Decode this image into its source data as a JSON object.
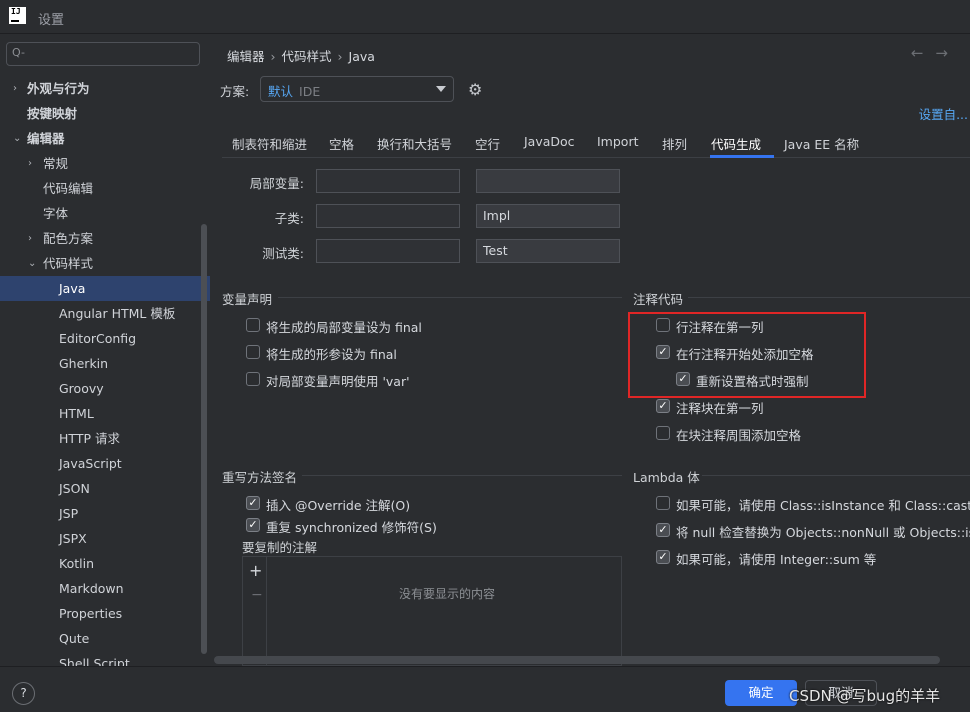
{
  "window": {
    "title": "设置",
    "app_icon_text": "IJ"
  },
  "sidebar": {
    "search_placeholder": "Q-",
    "items": [
      {
        "label": "外观与行为",
        "level": 0,
        "chevron": "›",
        "bold": true
      },
      {
        "label": "按键映射",
        "level": 0,
        "chevron": "",
        "bold": true
      },
      {
        "label": "编辑器",
        "level": 0,
        "chevron": "⌄",
        "bold": true
      },
      {
        "label": "常规",
        "level": 1,
        "chevron": "›"
      },
      {
        "label": "代码编辑",
        "level": 1,
        "chevron": ""
      },
      {
        "label": "字体",
        "level": 1,
        "chevron": ""
      },
      {
        "label": "配色方案",
        "level": 1,
        "chevron": "›"
      },
      {
        "label": "代码样式",
        "level": 1,
        "chevron": "⌄"
      },
      {
        "label": "Java",
        "level": 2,
        "chevron": "",
        "selected": true
      },
      {
        "label": "Angular HTML 模板",
        "level": 2,
        "chevron": ""
      },
      {
        "label": "EditorConfig",
        "level": 2,
        "chevron": ""
      },
      {
        "label": "Gherkin",
        "level": 2,
        "chevron": ""
      },
      {
        "label": "Groovy",
        "level": 2,
        "chevron": ""
      },
      {
        "label": "HTML",
        "level": 2,
        "chevron": ""
      },
      {
        "label": "HTTP 请求",
        "level": 2,
        "chevron": ""
      },
      {
        "label": "JavaScript",
        "level": 2,
        "chevron": ""
      },
      {
        "label": "JSON",
        "level": 2,
        "chevron": ""
      },
      {
        "label": "JSP",
        "level": 2,
        "chevron": ""
      },
      {
        "label": "JSPX",
        "level": 2,
        "chevron": ""
      },
      {
        "label": "Kotlin",
        "level": 2,
        "chevron": ""
      },
      {
        "label": "Markdown",
        "level": 2,
        "chevron": ""
      },
      {
        "label": "Properties",
        "level": 2,
        "chevron": ""
      },
      {
        "label": "Qute",
        "level": 2,
        "chevron": ""
      },
      {
        "label": "Shell Script",
        "level": 2,
        "chevron": ""
      }
    ]
  },
  "breadcrumb": {
    "items": [
      "编辑器",
      "代码样式",
      "Java"
    ],
    "separator": "›",
    "back_arrow": "←",
    "forward_arrow": "→"
  },
  "scheme": {
    "label": "方案:",
    "value": "默认",
    "sub": "IDE",
    "gear_icon": "⚙",
    "set_from": "设置自..."
  },
  "tabs": [
    {
      "label": "制表符和缩进"
    },
    {
      "label": "空格"
    },
    {
      "label": "换行和大括号"
    },
    {
      "label": "空行"
    },
    {
      "label": "JavaDoc"
    },
    {
      "label": "Import"
    },
    {
      "label": "排列"
    },
    {
      "label": "代码生成",
      "active": true
    },
    {
      "label": "Java EE 名称"
    }
  ],
  "naming": {
    "rows": [
      {
        "label": "局部变量:",
        "prefix": "",
        "suffix": ""
      },
      {
        "label": "子类:",
        "prefix": "",
        "suffix": "Impl"
      },
      {
        "label": "测试类:",
        "prefix": "",
        "suffix": "Test"
      }
    ]
  },
  "var_decl": {
    "title": "变量声明",
    "options": [
      {
        "label": "将生成的局部变量设为 final",
        "checked": false
      },
      {
        "label": "将生成的形参设为 final",
        "checked": false
      },
      {
        "label": "对局部变量声明使用 'var'",
        "checked": false
      }
    ]
  },
  "comment_code": {
    "title": "注释代码",
    "options": [
      {
        "label": "行注释在第一列",
        "checked": false
      },
      {
        "label": "在行注释开始处添加空格",
        "checked": true
      },
      {
        "label": "重新设置格式时强制",
        "checked": true
      },
      {
        "label": "注释块在第一列",
        "checked": true
      },
      {
        "label": "在块注释周围添加空格",
        "checked": false
      }
    ]
  },
  "override": {
    "title": "重写方法签名",
    "options": [
      {
        "label": "插入 @Override 注解(O)",
        "checked": true
      },
      {
        "label": "重复 synchronized 修饰符(S)",
        "checked": true
      }
    ],
    "copy_label": "要复制的注解",
    "add_icon": "+",
    "remove_icon": "−",
    "empty_text": "没有要显示的内容"
  },
  "lambda": {
    "title": "Lambda 体",
    "options": [
      {
        "label": "如果可能，请使用 Class::isInstance 和 Class::cast",
        "checked": false
      },
      {
        "label": "将 null 检查替换为 Objects::nonNull 或 Objects::isNu",
        "checked": true
      },
      {
        "label": "如果可能，请使用 Integer::sum 等",
        "checked": true
      }
    ]
  },
  "footer": {
    "help": "?",
    "ok": "确定",
    "cancel": "取消"
  },
  "watermark": "CSDN @写bug的羊羊",
  "colors": {
    "accent": "#3574f0",
    "link": "#57a8f5",
    "highlight_box": "#e02626",
    "selected_row": "#2e436e"
  }
}
